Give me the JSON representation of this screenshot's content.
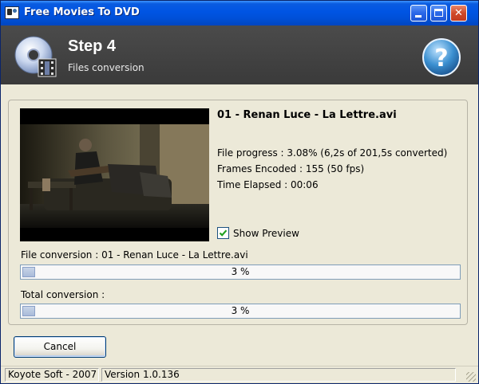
{
  "window": {
    "title": "Free Movies To DVD"
  },
  "header": {
    "step": "Step 4",
    "subtitle": "Files conversion"
  },
  "file": {
    "name": "01 - Renan Luce - La Lettre.avi",
    "progress": "File progress : 3.08% (6,2s of 201,5s converted)",
    "frames": "Frames Encoded : 155 (50 fps)",
    "elapsed": "Time Elapsed : 00:06"
  },
  "preview_checkbox": {
    "label": "Show Preview",
    "checked": true
  },
  "file_conversion": {
    "label": "File conversion : 01 - Renan Luce - La Lettre.avi",
    "percent_text": "3 %",
    "percent": 3
  },
  "total_conversion": {
    "label": "Total conversion :",
    "percent_text": "3 %",
    "percent": 3
  },
  "buttons": {
    "cancel": "Cancel"
  },
  "statusbar": {
    "company": "Koyote Soft - 2007",
    "version": "Version 1.0.136"
  },
  "icons": {
    "app": "film-icon",
    "disc": "dvd-disc-icon",
    "help": "help-icon"
  },
  "colors": {
    "titlebar": "#0054e3",
    "header": "#404040",
    "progress_fill": "#a9bbd9",
    "accent_help": "#3a8fd0"
  }
}
